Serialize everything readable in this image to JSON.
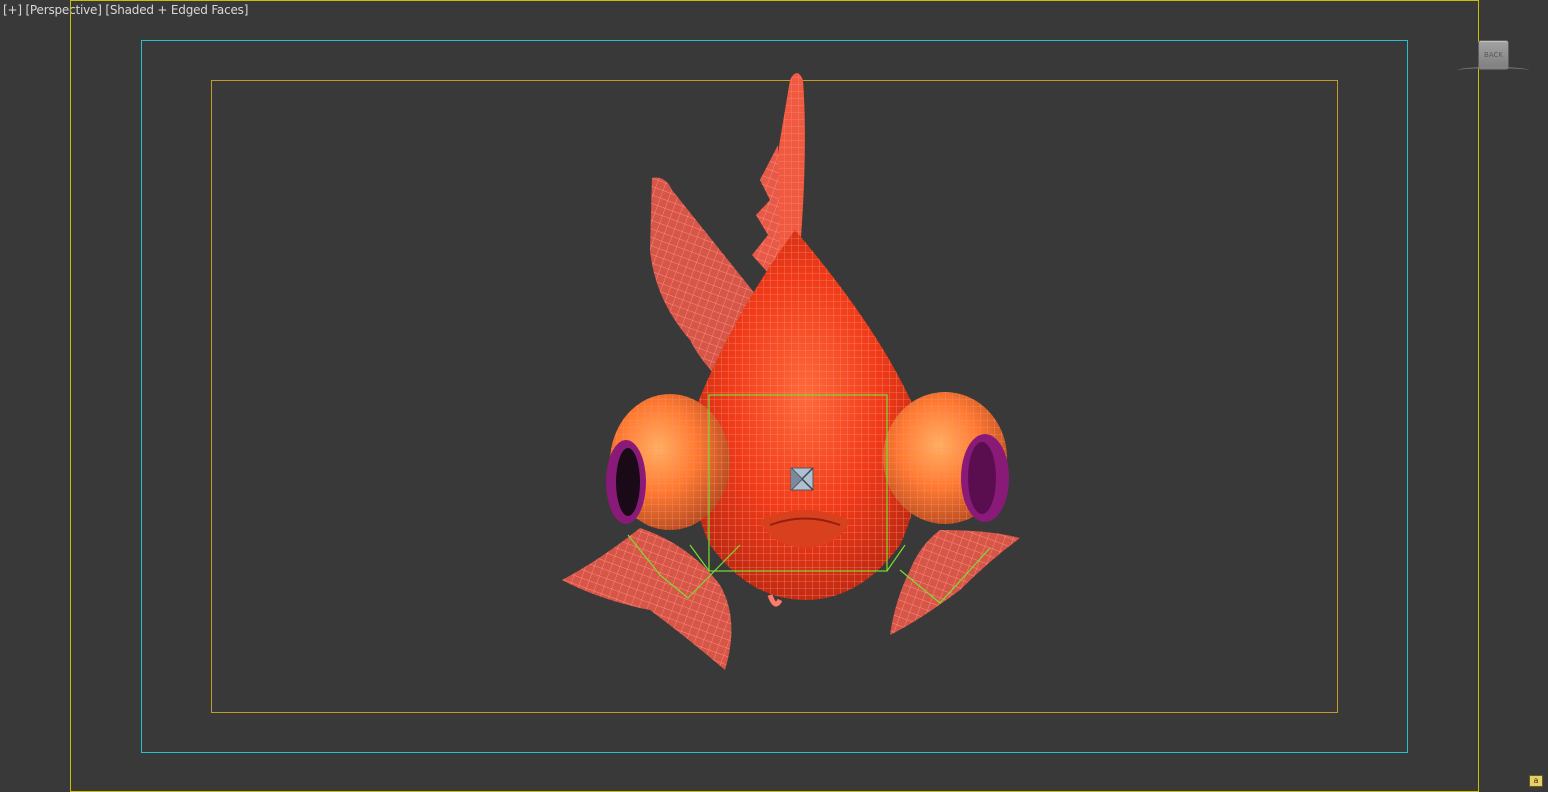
{
  "viewport": {
    "label_plus": "[+]",
    "label_view": "[Perspective]",
    "label_shading": "[Shaded + Edged Faces]",
    "background": "#393939"
  },
  "viewcube": {
    "face_label": "BACK"
  },
  "scene_object": {
    "name_icon": "goldfish-mesh",
    "body_color": "#ff4a1a",
    "wire_color": "#ff8a7a",
    "eye_color": "#8a1a78",
    "selection_color": "#7cdc30"
  },
  "frames": {
    "outer_color": "#c8c000",
    "safe_color": "#29bfd0",
    "title_color": "#c49b26"
  },
  "corner_badge": "a"
}
